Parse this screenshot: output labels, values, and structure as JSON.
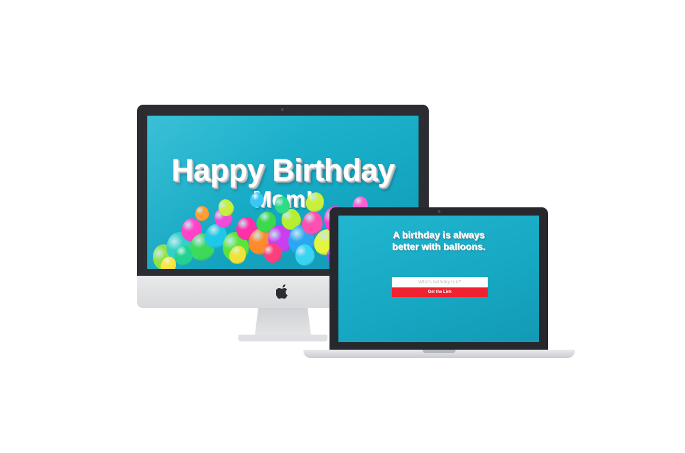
{
  "desktop": {
    "headline": "Happy Birthday",
    "subhead": "Mom!"
  },
  "laptop": {
    "tagline_line1": "A birthday is always",
    "tagline_line2": "better with balloons.",
    "name_field": {
      "placeholder": "Who's birthday is it?",
      "value": ""
    },
    "get_link_label": "Get the Link"
  },
  "colors": {
    "screen_background": "#17aac5",
    "button": "#ee2230",
    "device_frame": "#2b2d32",
    "aluminum": "#dfe0e3"
  },
  "icons": {
    "imac_chin_logo": "apple-logo-icon"
  }
}
